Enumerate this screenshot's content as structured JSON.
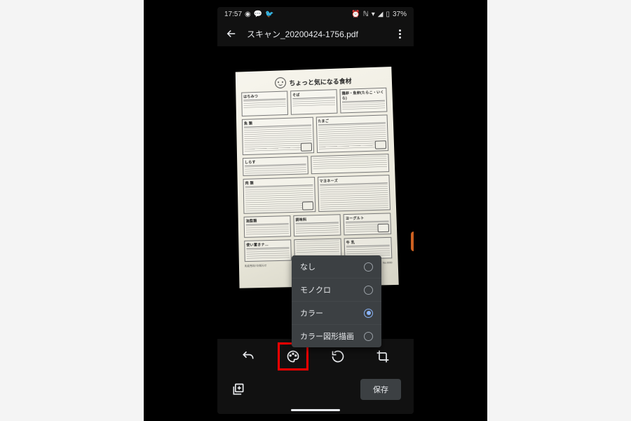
{
  "status": {
    "time": "17:57",
    "left_icons": [
      "line-icon",
      "speech-icon",
      "twitter-icon"
    ],
    "right_icons": [
      "alarm-icon",
      "nfc-icon",
      "wifi-off-icon",
      "signal-icon",
      "battery-icon"
    ],
    "battery_text": "37%"
  },
  "appbar": {
    "title": "スキャン_20200424-1756.pdf"
  },
  "document": {
    "title": "ちょっと気になる食材",
    "cells": {
      "r1c1": "はちみつ",
      "r1c2": "そば",
      "r1c3": "鶏卵・魚卵(たらこ・いくら)",
      "r2c1": "魚 類",
      "r2c2": "たまご",
      "r3c1": "しらす",
      "r4c1": "肉 類",
      "r4c2": "マヨネーズ",
      "r5c1": "油脂類",
      "r5c2": "調味料",
      "r5c3": "ヨーグルト",
      "r6c1": "使い置きナ…",
      "r6c3": "牛 乳"
    },
    "footer_left": "乳幼児向けお知らせ",
    "footer_right": "No.0000"
  },
  "color_menu": {
    "options": [
      "なし",
      "モノクロ",
      "カラー",
      "カラー図形描画"
    ],
    "selected_index": 2
  },
  "tools": {
    "undo": "undo",
    "palette": "palette",
    "rotate": "rotate",
    "crop": "crop"
  },
  "bottom": {
    "add_page": "add-page",
    "save_label": "保存"
  }
}
